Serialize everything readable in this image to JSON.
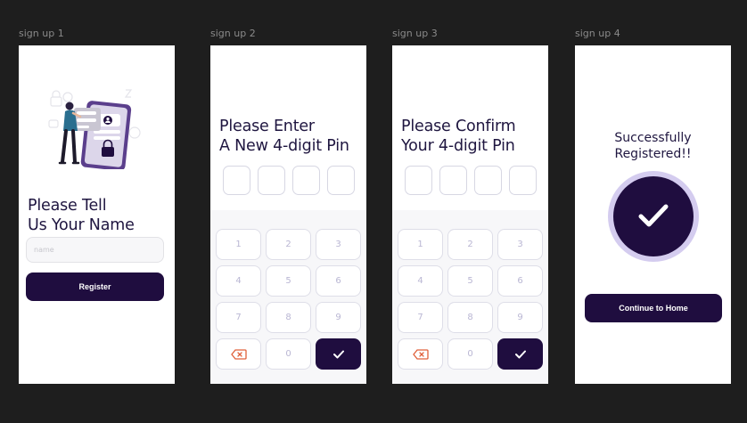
{
  "frames": [
    {
      "label": "sign up 1"
    },
    {
      "label": "sign up 2"
    },
    {
      "label": "sign up 3"
    },
    {
      "label": "sign up 4"
    }
  ],
  "signup1": {
    "title_line1": "Please Tell",
    "title_line2": "Us Your Name",
    "name_placeholder": "name",
    "name_value": "",
    "register_label": "Register"
  },
  "signup2": {
    "title_line1": "Please Enter",
    "title_line2": "A New 4-digit Pin"
  },
  "signup3": {
    "title_line1": "Please Confirm",
    "title_line2": "Your 4-digit Pin"
  },
  "keypad": {
    "digits": [
      "1",
      "2",
      "3",
      "4",
      "5",
      "6",
      "7",
      "8",
      "9"
    ],
    "zero": "0",
    "backspace_icon": "backspace-icon",
    "confirm_icon": "check-icon"
  },
  "signup4": {
    "success_line1": "Successfully",
    "success_line2": "Registered!!",
    "continue_label": "Continue to Home",
    "status_icon": "check-icon"
  },
  "colors": {
    "canvas": "#1e1e1e",
    "primary": "#1f0d3f",
    "primary_light": "#d4ccef",
    "backspace": "#e0603a",
    "keypad_digit": "#b9b6d3"
  }
}
